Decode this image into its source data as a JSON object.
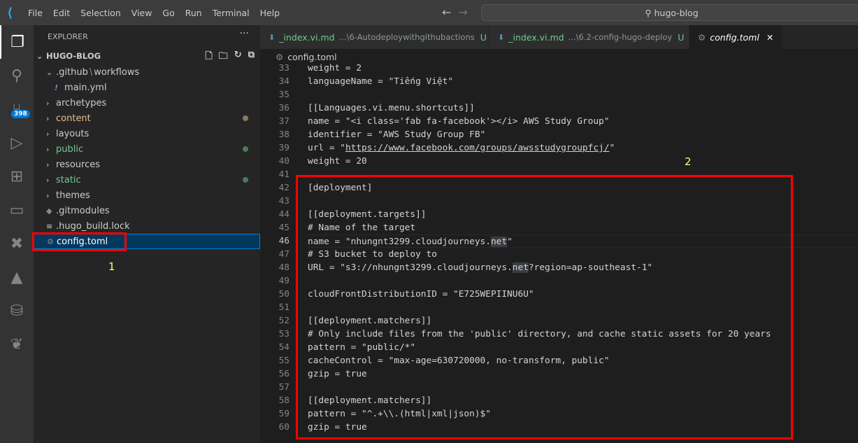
{
  "titlebar": {
    "menu": [
      "File",
      "Edit",
      "Selection",
      "View",
      "Go",
      "Run",
      "Terminal",
      "Help"
    ],
    "search": "hugo-blog",
    "accent": "#23a9f2"
  },
  "activity": {
    "icons": [
      "files-icon",
      "search-icon",
      "source-control-icon",
      "run-debug-icon",
      "extensions-icon",
      "remote-explorer-icon",
      "x-icon",
      "azure-icon",
      "database-icon",
      "leaf-icon"
    ],
    "scm_badge": "398"
  },
  "sidebar": {
    "title": "EXPLORER",
    "more": "···",
    "root": "HUGO-BLOG",
    "items": [
      {
        "label": ".github",
        "sep": "\\",
        "label2": "workflows",
        "kind": "folder-open",
        "indent": 1,
        "color": "#cccccc"
      },
      {
        "label": "main.yml",
        "kind": "yaml",
        "indent": 2,
        "color": "#cccccc"
      },
      {
        "label": "archetypes",
        "kind": "folder",
        "indent": 1,
        "color": "#cccccc"
      },
      {
        "label": "content",
        "kind": "folder",
        "indent": 1,
        "color": "#e2c08d",
        "dot": "#8a7a62"
      },
      {
        "label": "layouts",
        "kind": "folder",
        "indent": 1,
        "color": "#cccccc"
      },
      {
        "label": "public",
        "kind": "folder",
        "indent": 1,
        "color": "#73c991",
        "dot": "#4b7a57"
      },
      {
        "label": "resources",
        "kind": "folder",
        "indent": 1,
        "color": "#cccccc"
      },
      {
        "label": "static",
        "kind": "folder",
        "indent": 1,
        "color": "#73c991",
        "dot": "#4b7a57"
      },
      {
        "label": "themes",
        "kind": "folder",
        "indent": 1,
        "color": "#cccccc"
      },
      {
        "label": ".gitmodules",
        "kind": "git",
        "indent": 1,
        "color": "#cccccc"
      },
      {
        "label": ".hugo_build.lock",
        "kind": "lines",
        "indent": 1,
        "color": "#cccccc"
      },
      {
        "label": "config.toml",
        "kind": "gear",
        "indent": 1,
        "color": "#ffffff",
        "selected": true
      }
    ]
  },
  "tabs": [
    {
      "name": "_index.vi.md",
      "path": "...\\6-Autodeploywithgithubactions",
      "status": "U"
    },
    {
      "name": "_index.vi.md",
      "path": "...\\6.2-config-hugo-deploy",
      "status": "U"
    },
    {
      "name": "config.toml",
      "active": true,
      "close": "✕"
    }
  ],
  "breadcrumb": "config.toml",
  "code": [
    {
      "n": "33",
      "s": [
        {
          "t": "weight = 2"
        }
      ]
    },
    {
      "n": "34",
      "s": [
        {
          "t": "languageName = \"Tiếng Việt\""
        }
      ]
    },
    {
      "n": "35",
      "s": []
    },
    {
      "n": "36",
      "s": [
        {
          "t": "[[Languages.vi.menu.shortcuts]]"
        }
      ]
    },
    {
      "n": "37",
      "s": [
        {
          "t": "name = \"<i class='fab fa-facebook'></i> AWS Study Group\""
        }
      ]
    },
    {
      "n": "38",
      "s": [
        {
          "t": "identifier = \"AWS Study Group FB\""
        }
      ]
    },
    {
      "n": "39",
      "s": [
        {
          "t": "url = \""
        },
        {
          "t": "https://www.facebook.com/groups/awsstudygroupfcj/",
          "link": true
        },
        {
          "t": "\""
        }
      ]
    },
    {
      "n": "40",
      "s": [
        {
          "t": "weight = 20"
        }
      ]
    },
    {
      "n": "41",
      "s": []
    },
    {
      "n": "42",
      "s": [
        {
          "t": "[deployment]"
        }
      ]
    },
    {
      "n": "43",
      "s": []
    },
    {
      "n": "44",
      "s": [
        {
          "t": "[[deployment.targets]]"
        }
      ]
    },
    {
      "n": "45",
      "s": [
        {
          "t": "# Name of the target"
        }
      ]
    },
    {
      "n": "46",
      "cur": true,
      "s": [
        {
          "t": "name = \"nhungnt3299.cloudjourneys."
        },
        {
          "t": "net",
          "hl": true
        },
        {
          "t": "\""
        }
      ]
    },
    {
      "n": "47",
      "s": [
        {
          "t": "# S3 bucket to deploy to"
        }
      ]
    },
    {
      "n": "48",
      "s": [
        {
          "t": "URL = \"s3://nhungnt3299.cloudjourneys."
        },
        {
          "t": "net",
          "hl": true
        },
        {
          "t": "?region=ap-southeast-1\""
        }
      ]
    },
    {
      "n": "49",
      "s": []
    },
    {
      "n": "50",
      "s": [
        {
          "t": "cloudFrontDistributionID = \"E725WEPIINU6U\""
        }
      ]
    },
    {
      "n": "51",
      "s": []
    },
    {
      "n": "52",
      "s": [
        {
          "t": "[[deployment.matchers]]"
        }
      ]
    },
    {
      "n": "53",
      "s": [
        {
          "t": "# Only include files from the 'public' directory, and cache static assets for 20 years"
        }
      ]
    },
    {
      "n": "54",
      "s": [
        {
          "t": "pattern = \"public/*\""
        }
      ]
    },
    {
      "n": "55",
      "s": [
        {
          "t": "cacheControl = \"max-age=630720000, no-transform, public\""
        }
      ]
    },
    {
      "n": "56",
      "s": [
        {
          "t": "gzip = true"
        }
      ]
    },
    {
      "n": "57",
      "s": []
    },
    {
      "n": "58",
      "s": [
        {
          "t": "[[deployment.matchers]]"
        }
      ]
    },
    {
      "n": "59",
      "s": [
        {
          "t": "pattern = \"^.+\\\\.(html|xml|json)$\""
        }
      ]
    },
    {
      "n": "60",
      "s": [
        {
          "t": "gzip = true"
        }
      ]
    }
  ],
  "annotations": {
    "one": "1",
    "two": "2",
    "highlight_color": "#ff0000",
    "label_color": "#ffff66"
  }
}
